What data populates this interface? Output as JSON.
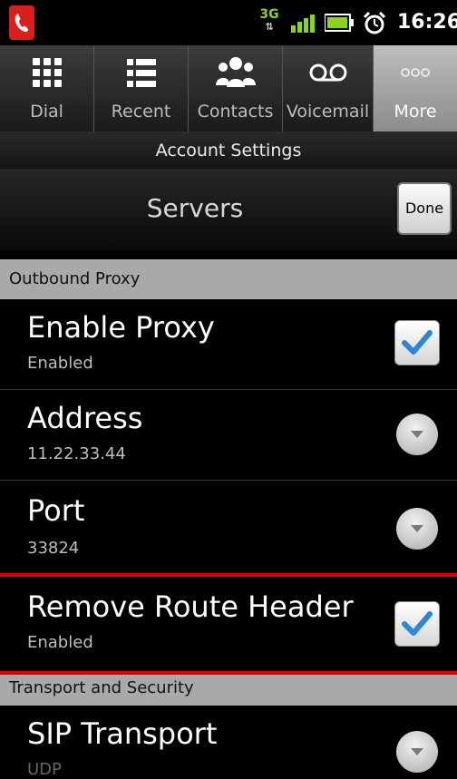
{
  "status_bar": {
    "network": "3G",
    "network_arrows": "⇅",
    "time": "16:26",
    "app_icon": "phone-handset-icon",
    "signal_icon": "signal-bars-icon",
    "battery_icon": "battery-icon",
    "alarm_icon": "alarm-clock-icon"
  },
  "tabs": [
    {
      "label": "Dial",
      "icon": "dialpad-icon",
      "active": false
    },
    {
      "label": "Recent",
      "icon": "list-icon",
      "active": false
    },
    {
      "label": "Contacts",
      "icon": "people-icon",
      "active": false
    },
    {
      "label": "Voicemail",
      "icon": "voicemail-icon",
      "active": false
    },
    {
      "label": "More",
      "icon": "more-dots-icon",
      "active": true
    }
  ],
  "account_settings_label": "Account Settings",
  "page_title": "Servers",
  "done_button": "Done",
  "sections": {
    "outbound_proxy": "Outbound Proxy",
    "transport_security": "Transport and Security"
  },
  "rows": {
    "enable_proxy": {
      "title": "Enable Proxy",
      "subtitle": "Enabled",
      "checked": true
    },
    "address": {
      "title": "Address",
      "subtitle": "11.22.33.44"
    },
    "port": {
      "title": "Port",
      "subtitle": "33824"
    },
    "remove_route_header": {
      "title": "Remove Route Header",
      "subtitle": "Enabled",
      "checked": true
    },
    "sip_transport": {
      "title": "SIP Transport",
      "subtitle": "UDP"
    }
  },
  "colors": {
    "accent_check": "#2f86d6",
    "highlight_line": "#e00000",
    "network_3g": "#8ed11f",
    "app_icon_bg": "#d91e1e"
  }
}
